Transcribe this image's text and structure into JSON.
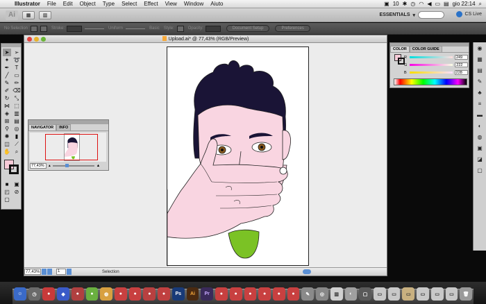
{
  "menubar": {
    "app_name": "Illustrator",
    "items": [
      "File",
      "Edit",
      "Object",
      "Type",
      "Select",
      "Effect",
      "View",
      "Window",
      "Aiuto"
    ],
    "status": {
      "badge": "10",
      "clock": "gio 22:14"
    }
  },
  "appbar": {
    "logo": "Ai",
    "workspace": "ESSENTIALS",
    "cs_live": "CS Live"
  },
  "controlbar": {
    "selection": "No Selection",
    "stroke_label": "Stroke:",
    "uniform": "Uniform",
    "basic": "Basic",
    "style": "Style:",
    "opacity": "Opacity:",
    "document_setup": "Document Setup",
    "preferences": "Preferences"
  },
  "document": {
    "title": "Upload.ai* @ 77,43% (RGB/Preview)",
    "zoom": "77,43%",
    "page": "1",
    "mode": "Selection"
  },
  "navigator": {
    "tabs": [
      "NAVIGATOR",
      "INFO"
    ],
    "zoom": "77,43%"
  },
  "color_panel": {
    "tabs": [
      "COLOR",
      "COLOR GUIDE"
    ],
    "channels": [
      {
        "label": "R",
        "value": "249"
      },
      {
        "label": "G",
        "value": "222"
      },
      {
        "label": "B",
        "value": "228"
      }
    ],
    "fill_color": "#f8cbd8"
  },
  "artwork": {
    "skin": "#f9d5e1",
    "hair": "#1a1436",
    "tongue": "#7bc225",
    "iris": "#8a5a1e"
  }
}
